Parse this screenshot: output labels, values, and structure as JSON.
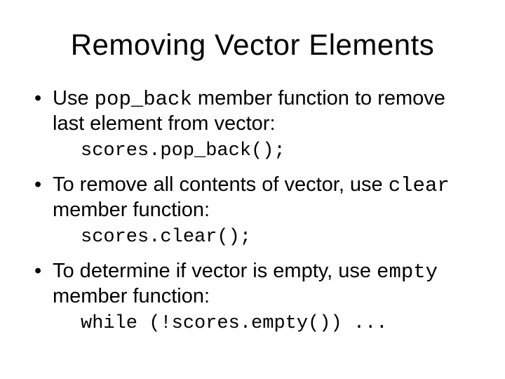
{
  "title": "Removing Vector Elements",
  "bullets": [
    {
      "pre": "Use ",
      "code": "pop_back",
      "post": " member function to remove last element from vector:",
      "example": "scores.pop_back();"
    },
    {
      "pre": "To remove all contents of vector, use ",
      "code": "clear",
      "post": " member function:",
      "example": "scores.clear();"
    },
    {
      "pre": "To determine if vector is empty, use ",
      "code": "empty",
      "post": " member function:",
      "example": "while (!scores.empty()) ..."
    }
  ]
}
